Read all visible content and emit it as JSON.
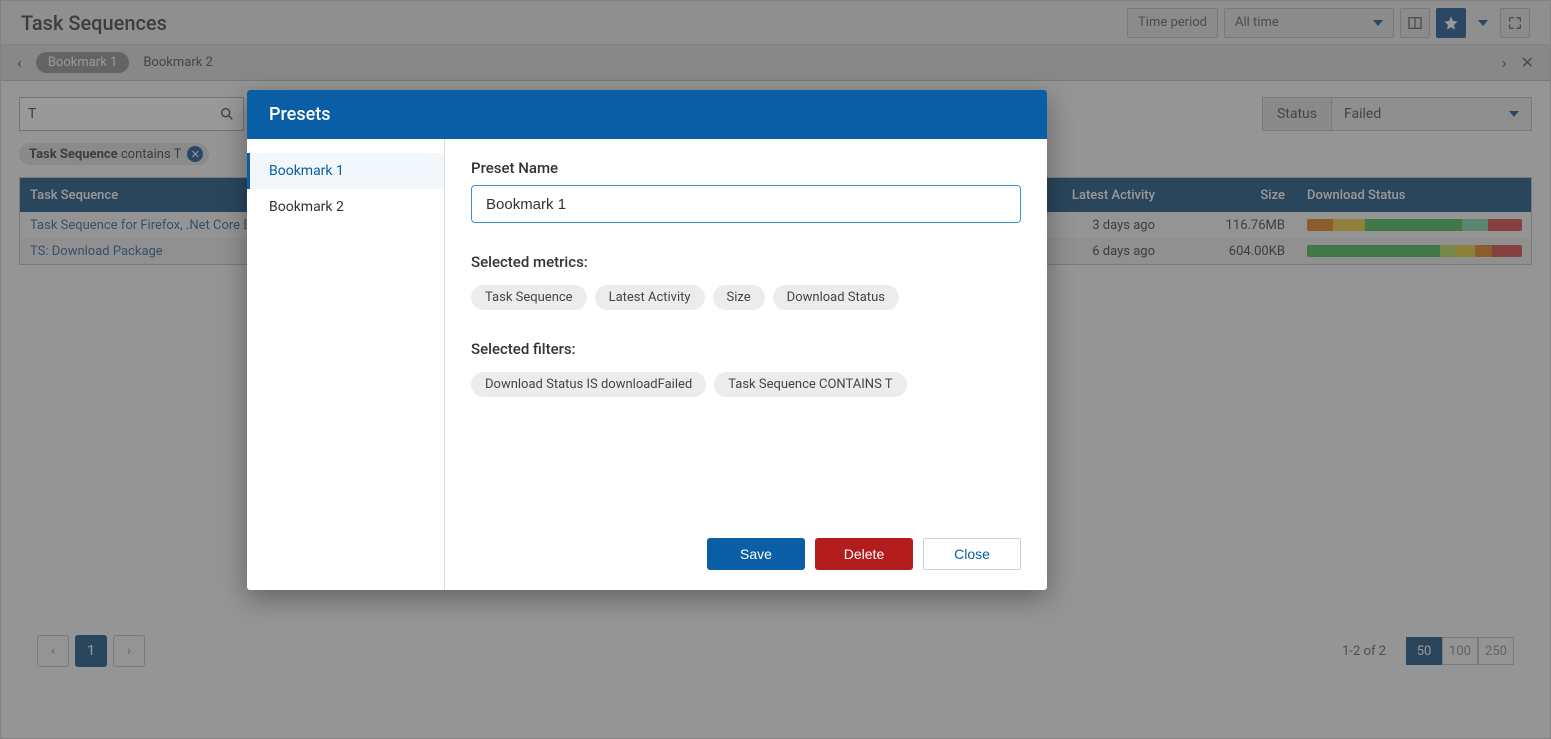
{
  "header": {
    "title": "Task Sequences",
    "time_period_label": "Time period",
    "time_period_value": "All time"
  },
  "bookmark_bar": {
    "active": "Bookmark 1",
    "other": "Bookmark 2"
  },
  "filters": {
    "search_value": "T",
    "status_label": "Status",
    "status_value": "Failed",
    "tag_prefix": "Task Sequence",
    "tag_middle": " contains ",
    "tag_term": "T"
  },
  "table": {
    "headers": {
      "task_sequence": "Task Sequence",
      "latest_activity": "Latest Activity",
      "size": "Size",
      "download_status": "Download Status"
    },
    "rows": [
      {
        "name": "Task Sequence for Firefox, .Net Core B",
        "latest": "3 days ago",
        "size": "116.76MB",
        "bars": [
          {
            "c": "#e07b10",
            "w": 12
          },
          {
            "c": "#e8c92a",
            "w": 15
          },
          {
            "c": "#3fb54a",
            "w": 45
          },
          {
            "c": "#7ad0a0",
            "w": 12
          },
          {
            "c": "#d53a3a",
            "w": 16
          }
        ]
      },
      {
        "name": "TS: Download Package",
        "latest": "6 days ago",
        "size": "604.00KB",
        "bars": [
          {
            "c": "#3fb54a",
            "w": 62
          },
          {
            "c": "#b6d94a",
            "w": 8
          },
          {
            "c": "#e8c92a",
            "w": 8
          },
          {
            "c": "#e07b10",
            "w": 8
          },
          {
            "c": "#d53a3a",
            "w": 14
          }
        ]
      }
    ]
  },
  "pager": {
    "current": "1",
    "info": "1-2 of 2",
    "sizes": [
      "50",
      "100",
      "250"
    ],
    "active_size": "50"
  },
  "modal": {
    "title": "Presets",
    "sidebar": [
      "Bookmark 1",
      "Bookmark 2"
    ],
    "active_sidebar": "Bookmark 1",
    "preset_name_label": "Preset Name",
    "preset_name_value": "Bookmark 1",
    "metrics_label": "Selected metrics:",
    "metrics": [
      "Task Sequence",
      "Latest Activity",
      "Size",
      "Download Status"
    ],
    "filters_label": "Selected filters:",
    "filters": [
      "Download Status IS downloadFailed",
      "Task Sequence CONTAINS T"
    ],
    "buttons": {
      "save": "Save",
      "delete": "Delete",
      "close": "Close"
    }
  }
}
